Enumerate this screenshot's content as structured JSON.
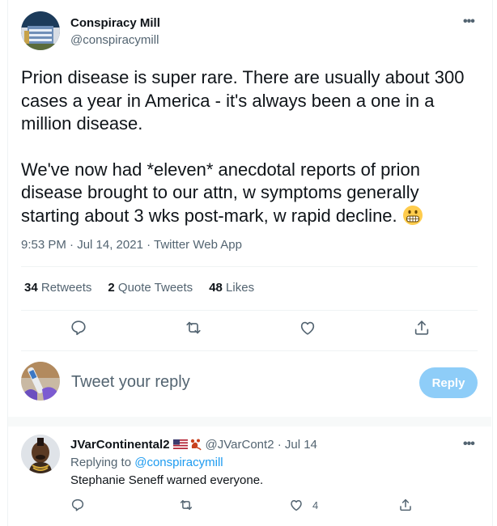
{
  "tweet": {
    "author_name": "Conspiracy Mill",
    "author_handle": "@conspiracymill",
    "more_label": "•••",
    "body_p1": "Prion disease is super rare. There are usually about 300 cases a year in America - it's always been a one in a million disease.",
    "body_p2": "We've now had *eleven* anecdotal reports of prion disease brought to our attn, w symptoms generally starting about 3 wks post-mark, w rapid decline.",
    "emoji_icon": "grimacing-face-emoji",
    "timestamp": "9:53 PM · Jul 14, 2021",
    "source_sep": " · ",
    "source": "Twitter Web App",
    "stats": {
      "retweets_count": "34",
      "retweets_label": "Retweets",
      "quotes_count": "2",
      "quotes_label": "Quote Tweets",
      "likes_count": "48",
      "likes_label": "Likes"
    },
    "actions": [
      "reply-icon",
      "retweet-icon",
      "like-icon",
      "share-icon"
    ]
  },
  "compose": {
    "placeholder": "Tweet your reply",
    "reply_button": "Reply"
  },
  "reply": {
    "author_name": "JVarContinental2",
    "flag_icon": "us-flag-emoji",
    "lobster_icon": "lobster-emoji",
    "author_handle": "@JVarCont2",
    "date_sep": " · ",
    "date": "Jul 14",
    "more_label": "•••",
    "replying_prefix": "Replying to ",
    "replying_to": "@conspiracymill",
    "text": "Stephanie Seneff warned everyone.",
    "like_count": "4"
  },
  "colors": {
    "accent": "#1d9bf0",
    "reply_button_disabled": "#8ecdf8",
    "secondary_text": "#536471",
    "divider": "#eff3f4"
  }
}
